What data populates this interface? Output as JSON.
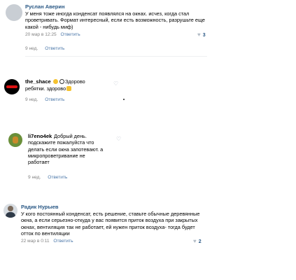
{
  "comments": [
    {
      "author": "Руслан Аверин",
      "lines": [
        "У меня тоже иногда конденсат появлялся на окнах. исчез, когда стал",
        "проветривать. Формат интересный, если есть возможность, разрушьте еще",
        "какой - нибудь миф)"
      ],
      "date": "20 мар в 12:25",
      "reply": "Ответить",
      "likes": "3"
    },
    {
      "author": "the_shace",
      "lines": [
        "Здорово",
        "ребятки. здорово"
      ],
      "date": "9 нед.",
      "reply": "Ответить",
      "likes": ""
    },
    {
      "author": "li7eno4ek",
      "lines": [
        "Добрый день.",
        "подскажите пожалуйста что",
        "делать если окна запотевают. а",
        "микропроветривание не",
        "работает"
      ],
      "date": "9 нед.",
      "reply": "Ответить",
      "likes": ""
    },
    {
      "author": "Радик Нурыев",
      "lines": [
        "У кого постоянный конденсат, есть решение, ставьте обычные деревянные",
        "окна, а если серьезно-откуда у вас появится приток воздуха при закрытых",
        "окнах, вентиляция так не работает, ей нужен приток воздуха- тогда будет",
        "отток по вентиляции"
      ],
      "date": "22 мар в 0:11",
      "reply": "Ответить",
      "likes": "2"
    }
  ],
  "first_reply_date": "9 нед.",
  "first_reply_label": "Ответить",
  "colors": {
    "author": "#000000",
    "link": "#4a76a8",
    "meta": "#828282",
    "like_count": "#2a5885"
  }
}
